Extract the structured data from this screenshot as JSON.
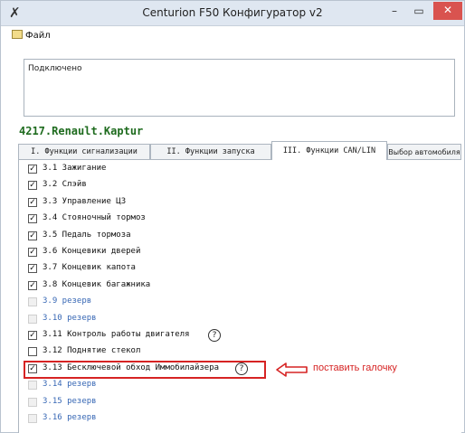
{
  "window": {
    "title": "Centurion F50 Конфигуратор v2",
    "min_label": "–",
    "max_label": "▭",
    "close_label": "✕"
  },
  "menu": {
    "file_label": "Файл"
  },
  "status": {
    "text": "Подключено"
  },
  "car": {
    "name": "4217.Renault.Kaptur"
  },
  "tabs": [
    {
      "label": "I. Функции сигнализации",
      "active": false
    },
    {
      "label": "II. Функции запуска",
      "active": false
    },
    {
      "label": "III. Функции CAN/LIN",
      "active": true
    },
    {
      "label": "Выбор автомобиля",
      "active": false
    }
  ],
  "options": [
    {
      "label": "3.1  Зажигание",
      "checked": true,
      "enabled": true
    },
    {
      "label": "3.2  Слэйв",
      "checked": true,
      "enabled": true
    },
    {
      "label": "3.3  Управление ЦЗ",
      "checked": true,
      "enabled": true
    },
    {
      "label": "3.4  Стояночный тормоз",
      "checked": true,
      "enabled": true
    },
    {
      "label": "3.5  Педаль тормоза",
      "checked": true,
      "enabled": true
    },
    {
      "label": "3.6  Концевики дверей",
      "checked": true,
      "enabled": true
    },
    {
      "label": "3.7  Концевик капота",
      "checked": true,
      "enabled": true
    },
    {
      "label": "3.8  Концевик багажника",
      "checked": true,
      "enabled": true
    },
    {
      "label": "3.9  резерв",
      "checked": false,
      "enabled": false
    },
    {
      "label": "3.10 резерв",
      "checked": false,
      "enabled": false
    },
    {
      "label": "3.11 Контроль работы двигателя",
      "checked": true,
      "enabled": true,
      "help": true
    },
    {
      "label": "3.12 Поднятие стекол",
      "checked": false,
      "enabled": true
    },
    {
      "label": "3.13 Бесключевой обход Иммобилайзера",
      "checked": true,
      "enabled": true,
      "help": true
    },
    {
      "label": "3.14 резерв",
      "checked": false,
      "enabled": false
    },
    {
      "label": "3.15 резерв",
      "checked": false,
      "enabled": false
    },
    {
      "label": "3.16 резерв",
      "checked": false,
      "enabled": false
    }
  ],
  "annotation": {
    "text": "поставить галочку",
    "color": "#d62323"
  },
  "icons": {
    "help": "?",
    "check": "✓",
    "app": "✗",
    "arrow": "left-arrow-icon"
  }
}
